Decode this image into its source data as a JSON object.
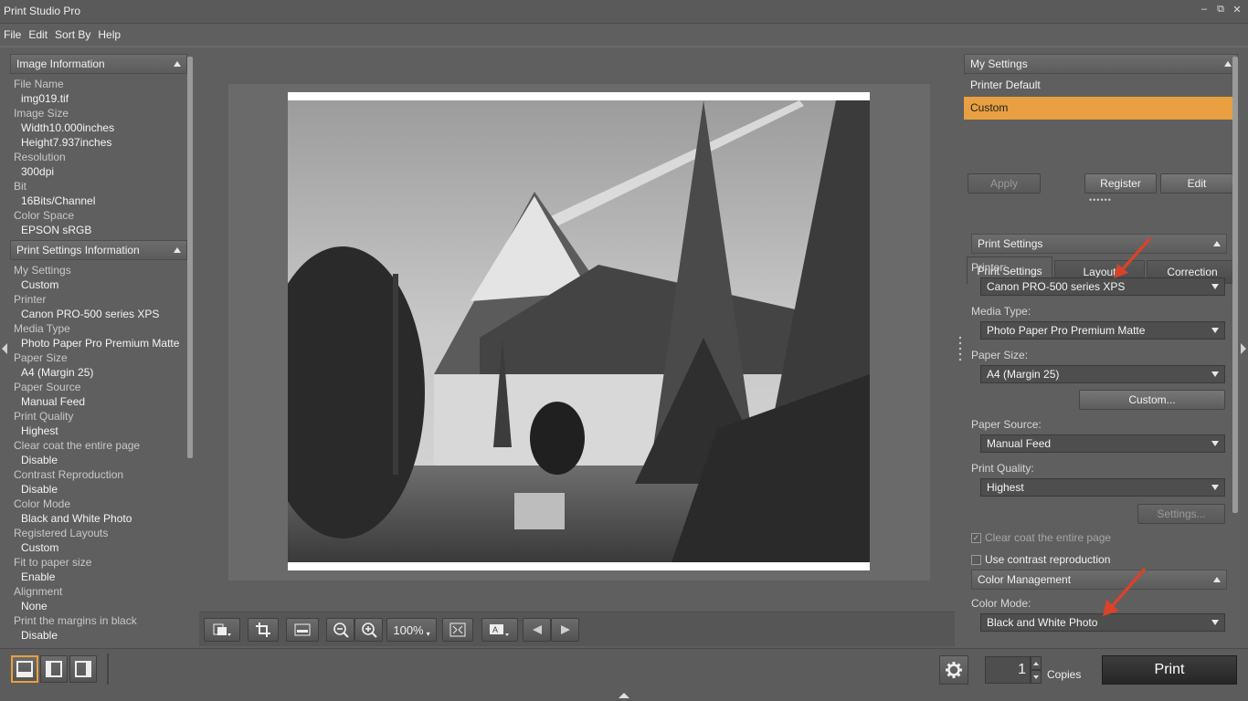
{
  "app": {
    "title": "Print Studio Pro"
  },
  "menu": [
    "File",
    "Edit",
    "Sort By",
    "Help"
  ],
  "image_info": {
    "header": "Image Information",
    "rows": [
      {
        "label": "File Name",
        "value": "img019.tif"
      },
      {
        "label": "Image Size",
        "value": "Width10.000inches"
      },
      {
        "label": "",
        "value": "Height7.937inches"
      },
      {
        "label": "Resolution",
        "value": "300dpi"
      },
      {
        "label": "Bit",
        "value": "16Bits/Channel"
      },
      {
        "label": "Color Space",
        "value": "EPSON  sRGB"
      }
    ]
  },
  "print_info": {
    "header": "Print Settings Information",
    "rows": [
      {
        "label": "My Settings",
        "value": "Custom"
      },
      {
        "label": "Printer",
        "value": "Canon PRO-500 series XPS"
      },
      {
        "label": "Media Type",
        "value": "Photo Paper Pro Premium Matte"
      },
      {
        "label": "Paper Size",
        "value": "A4 (Margin 25)"
      },
      {
        "label": "Paper Source",
        "value": "Manual Feed"
      },
      {
        "label": "Print Quality",
        "value": "Highest"
      },
      {
        "label": "Clear coat the entire page",
        "value": "Disable"
      },
      {
        "label": "Contrast Reproduction",
        "value": "Disable"
      },
      {
        "label": "Color Mode",
        "value": "Black and White Photo"
      },
      {
        "label": "Registered Layouts",
        "value": "Custom"
      },
      {
        "label": "Fit to paper size",
        "value": "Enable"
      },
      {
        "label": "Alignment",
        "value": "None"
      },
      {
        "label": "Print the margins in black",
        "value": "Disable"
      }
    ]
  },
  "toolbar": {
    "zoom": "100%"
  },
  "my_settings": {
    "header": "My Settings",
    "items": [
      "Printer Default",
      "Custom"
    ],
    "apply": "Apply",
    "register": "Register",
    "edit": "Edit"
  },
  "tabs": [
    "Print Settings",
    "Layout",
    "Correction"
  ],
  "print_settings": {
    "header": "Print Settings",
    "printer_label": "Printer:",
    "printer": "Canon PRO-500 series XPS",
    "media_label": "Media Type:",
    "media": "Photo Paper Pro Premium Matte",
    "size_label": "Paper Size:",
    "size": "A4 (Margin 25)",
    "custom_button": "Custom...",
    "source_label": "Paper Source:",
    "source": "Manual Feed",
    "quality_label": "Print Quality:",
    "quality": "Highest",
    "settings_button": "Settings...",
    "clear_coat": "Clear coat the entire page",
    "contrast": "Use contrast reproduction"
  },
  "color_management": {
    "header": "Color Management",
    "mode_label": "Color Mode:",
    "mode": "Black and White Photo"
  },
  "bottom": {
    "copies_value": "1",
    "copies_label": "Copies",
    "print": "Print"
  },
  "colors": {
    "accent": "#e8a040",
    "arrow": "#d8432a"
  }
}
